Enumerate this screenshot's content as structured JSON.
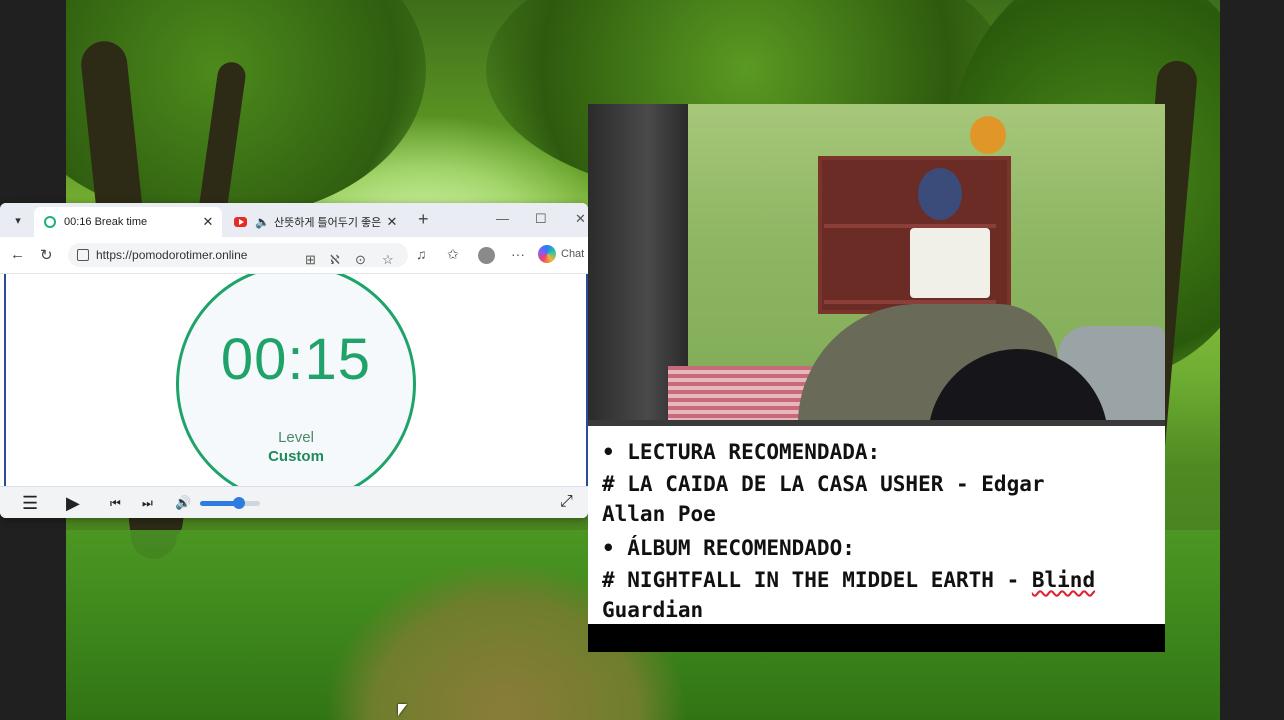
{
  "browser": {
    "tabs": [
      {
        "title": "00:16 Break time",
        "active": true,
        "favicon": "pomodoro-icon"
      },
      {
        "title": "산뜻하게 틀어두기 좋은",
        "active": false,
        "favicon": "youtube-icon"
      }
    ],
    "address": {
      "url": "https://pomodorotimer.online"
    },
    "copilot_label": "Chat",
    "window_controls": [
      "minimize",
      "maximize",
      "close"
    ]
  },
  "timer": {
    "display": "00:15",
    "level_label": "Level",
    "level_value": "Custom",
    "accent_color": "#1fa36a"
  },
  "media_controls": {
    "icons": [
      "menu-icon",
      "play-icon",
      "previous-icon",
      "next-icon",
      "volume-icon",
      "fullscreen-icon"
    ],
    "volume_level": 0.65
  },
  "notes": {
    "lines": [
      "• LECTURA RECOMENDADA:",
      "# LA CAIDA DE LA CASA USHER - Edgar",
      "Allan Poe",
      "• ÁLBUM RECOMENDADO:",
      "# NIGHTFALL IN THE MIDDEL EARTH - ",
      "Guardian"
    ],
    "misspelled_word": "Blind"
  }
}
